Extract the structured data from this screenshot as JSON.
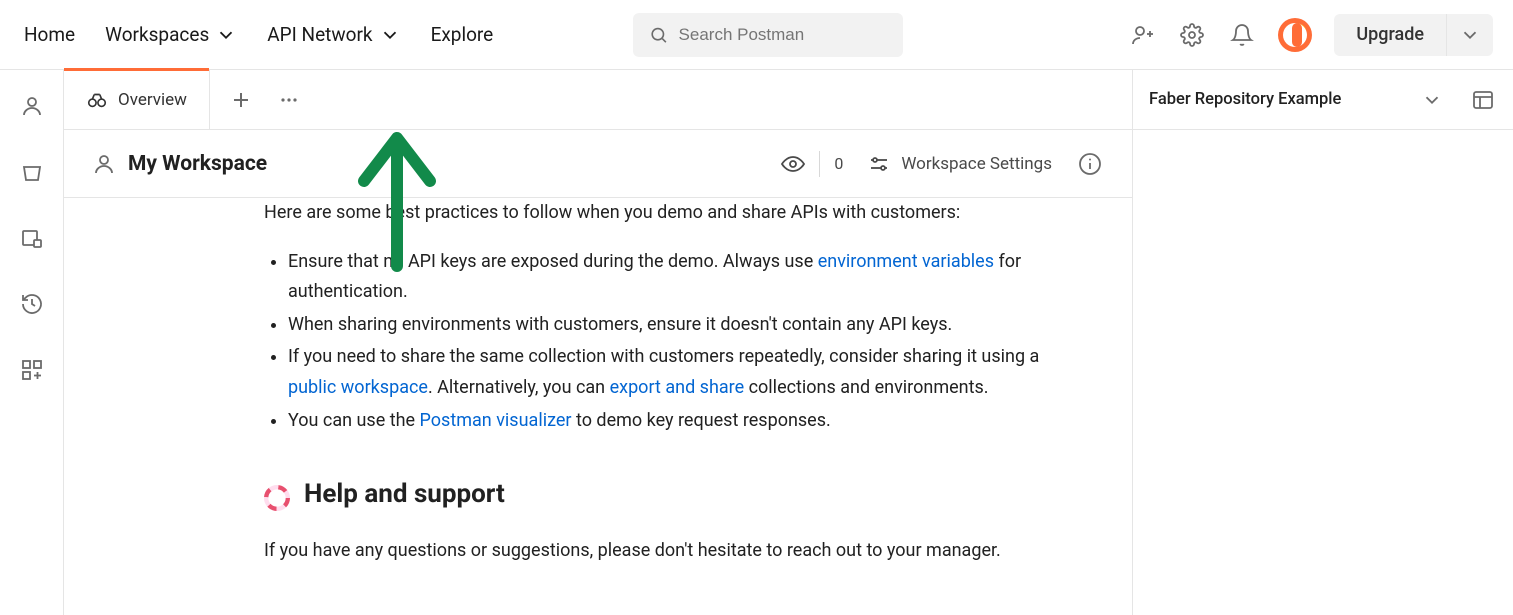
{
  "header": {
    "nav": {
      "home": "Home",
      "workspaces": "Workspaces",
      "api_network": "API Network",
      "explore": "Explore"
    },
    "search": {
      "placeholder": "Search Postman"
    },
    "upgrade_label": "Upgrade"
  },
  "tabs": {
    "overview_label": "Overview"
  },
  "environment": {
    "name": "Faber Repository Example"
  },
  "workspace": {
    "title": "My Workspace",
    "watch_count": "0",
    "settings_label": "Workspace Settings"
  },
  "content": {
    "truncated_intro": "Here are some best practices to follow when you demo and share APIs with customers:",
    "bullets": {
      "b0_pre": "Ensure that no API keys are exposed during the demo. Always use ",
      "b0_link": "environment variables",
      "b0_post": " for authentication.",
      "b1": "When sharing environments with customers, ensure it doesn't contain any API keys.",
      "b2_pre": "If you need to share the same collection with customers repeatedly, consider sharing it using a ",
      "b2_link_a": "public workspace",
      "b2_mid": ". Alternatively, you can ",
      "b2_link_b": "export and share",
      "b2_post": " collections and environments.",
      "b3_pre": "You can use the ",
      "b3_link": "Postman visualizer",
      "b3_post": " to demo key request responses."
    },
    "help_heading": "Help and support",
    "help_para": "If you have any questions or suggestions, please don't hesitate to reach out to your manager."
  }
}
